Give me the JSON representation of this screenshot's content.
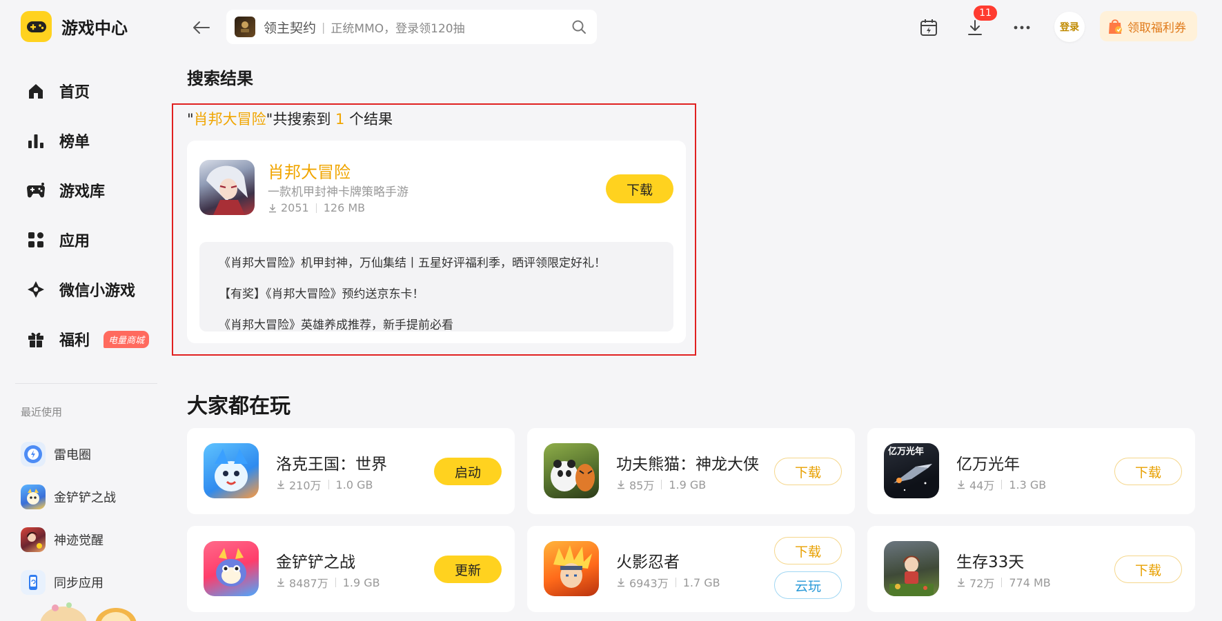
{
  "app": {
    "name": "游戏中心"
  },
  "nav": {
    "items": [
      {
        "label": "首页",
        "icon": "home-icon"
      },
      {
        "label": "榜单",
        "icon": "rank-chart-icon"
      },
      {
        "label": "游戏库",
        "icon": "gamepad-icon"
      },
      {
        "label": "应用",
        "icon": "apps-grid-icon"
      },
      {
        "label": "微信小游戏",
        "icon": "mini-game-icon"
      },
      {
        "label": "福利",
        "icon": "gift-icon",
        "badge": "电量商城"
      }
    ]
  },
  "recent": {
    "title": "最近使用",
    "items": [
      {
        "label": "雷电圈"
      },
      {
        "label": "金铲铲之战"
      },
      {
        "label": "神迹觉醒"
      },
      {
        "label": "同步应用"
      }
    ]
  },
  "search": {
    "main": "领主契约",
    "separator": "|",
    "sub": "正统MMO，登录领120抽"
  },
  "header": {
    "download_badge": "11",
    "login": "登录",
    "coupon": "领取福利券"
  },
  "results": {
    "title": "搜索结果",
    "count": {
      "open_quote": "\"",
      "keyword": "肖邦大冒险",
      "close_quote": "\"",
      "prefix": "共搜索到 ",
      "number": "1",
      "suffix": " 个结果"
    },
    "game": {
      "name": "肖邦大冒险",
      "desc": "一款机甲封神卡牌策略手游",
      "downloads": "2051",
      "size": "126 MB",
      "button": "下载",
      "news": [
        "《肖邦大冒险》机甲封神，万仙集结丨五星好评福利季，晒评领限定好礼！",
        "【有奖】《肖邦大冒险》预约送京东卡！",
        "《肖邦大冒险》英雄养成推荐，新手提前必看"
      ]
    }
  },
  "popular": {
    "title": "大家都在玩",
    "games": [
      {
        "name": "洛克王国：世界",
        "downloads": "210万",
        "size": "1.0 GB",
        "button": "启动"
      },
      {
        "name": "功夫熊猫：神龙大侠",
        "downloads": "85万",
        "size": "1.9 GB",
        "button": "下载"
      },
      {
        "name": "亿万光年",
        "downloads": "44万",
        "size": "1.3 GB",
        "button": "下载",
        "thumb_text": "亿万光年"
      },
      {
        "name": "金铲铲之战",
        "downloads": "8487万",
        "size": "1.9 GB",
        "button": "更新"
      },
      {
        "name": "火影忍者",
        "downloads": "6943万",
        "size": "1.7 GB",
        "button": "下载",
        "button2": "云玩"
      },
      {
        "name": "生存33天",
        "downloads": "72万",
        "size": "774 MB",
        "button": "下载"
      }
    ]
  },
  "colors": {
    "accent": "#ffd21f",
    "highlight": "#f0a500",
    "badge_red": "#ff3b30",
    "frame_red": "#e02020"
  }
}
